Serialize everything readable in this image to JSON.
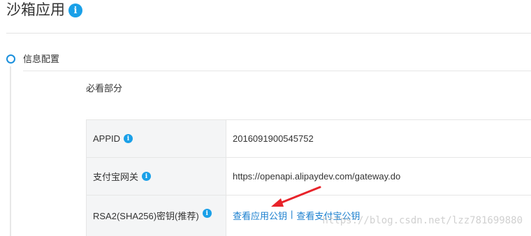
{
  "header": {
    "title": "沙箱应用",
    "info_icon": "i"
  },
  "step": {
    "label": "信息配置"
  },
  "section": {
    "heading": "必看部分"
  },
  "table": {
    "rows": [
      {
        "label": "APPID",
        "info_icon": "i",
        "value": "2016091900545752"
      },
      {
        "label": "支付宝网关",
        "info_icon": "i",
        "value": "https://openapi.alipaydev.com/gateway.do"
      },
      {
        "label": "RSA2(SHA256)密钥(推荐)",
        "info_icon": "i",
        "links": {
          "app_public_key": "查看应用公钥",
          "separator": "|",
          "alipay_public_key": "查看支付宝公钥"
        }
      }
    ]
  },
  "watermark": "https://blog.csdn.net/lzz781699880",
  "colors": {
    "accent": "#1aa0e8",
    "link": "#1a7fcf",
    "annotation_arrow": "#e8232a"
  }
}
